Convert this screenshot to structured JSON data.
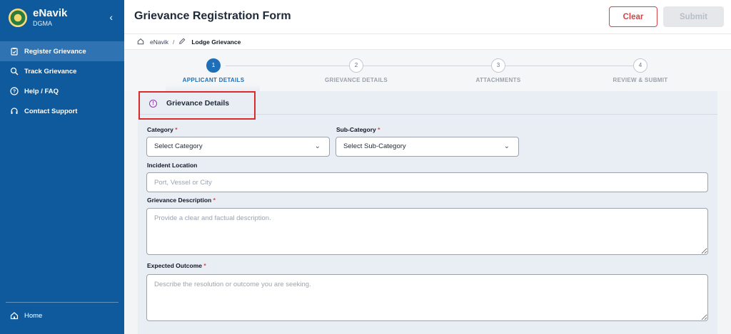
{
  "brand": {
    "title": "eNavik",
    "subtitle": "DGMA",
    "collapse_icon": "chevron-left-icon"
  },
  "sidebar": {
    "items": [
      {
        "label": "Register Grievance",
        "icon": "clipboard-check-icon",
        "active": true
      },
      {
        "label": "Track Grievance",
        "icon": "search-icon",
        "active": false
      },
      {
        "label": "Help / FAQ",
        "icon": "help-circle-icon",
        "active": false
      },
      {
        "label": "Contact Support",
        "icon": "headset-icon",
        "active": false
      }
    ],
    "home_label": "Home"
  },
  "header": {
    "title": "Grievance Registration Form",
    "clear_label": "Clear",
    "submit_label": "Submit"
  },
  "breadcrumb": {
    "root": "eNavik",
    "separator": "/",
    "current": "Lodge Grievance"
  },
  "stepper": {
    "steps": [
      {
        "num": "1",
        "label": "APPLICANT DETAILS",
        "active": true
      },
      {
        "num": "2",
        "label": "GRIEVANCE DETAILS",
        "active": false
      },
      {
        "num": "3",
        "label": "ATTACHMENTS",
        "active": false
      },
      {
        "num": "4",
        "label": "REVIEW & SUBMIT",
        "active": false
      }
    ]
  },
  "form": {
    "section_title": "Grievance Details",
    "category": {
      "label": "Category",
      "required": "*",
      "value": "Select Category"
    },
    "subcategory": {
      "label": "Sub-Category",
      "required": "*",
      "value": "Select Sub-Category"
    },
    "location": {
      "label": "Incident Location",
      "placeholder": "Port, Vessel or City"
    },
    "description": {
      "label": "Grievance Description",
      "required": "*",
      "placeholder": "Provide a clear and factual description."
    },
    "outcome": {
      "label": "Expected Outcome",
      "required": "*",
      "placeholder": "Describe the resolution or outcome you are seeking."
    }
  },
  "colors": {
    "sidebar": "#0e5a9c",
    "accent": "#1f6fb8",
    "danger": "#d64545",
    "highlight": "#d92b2b"
  }
}
